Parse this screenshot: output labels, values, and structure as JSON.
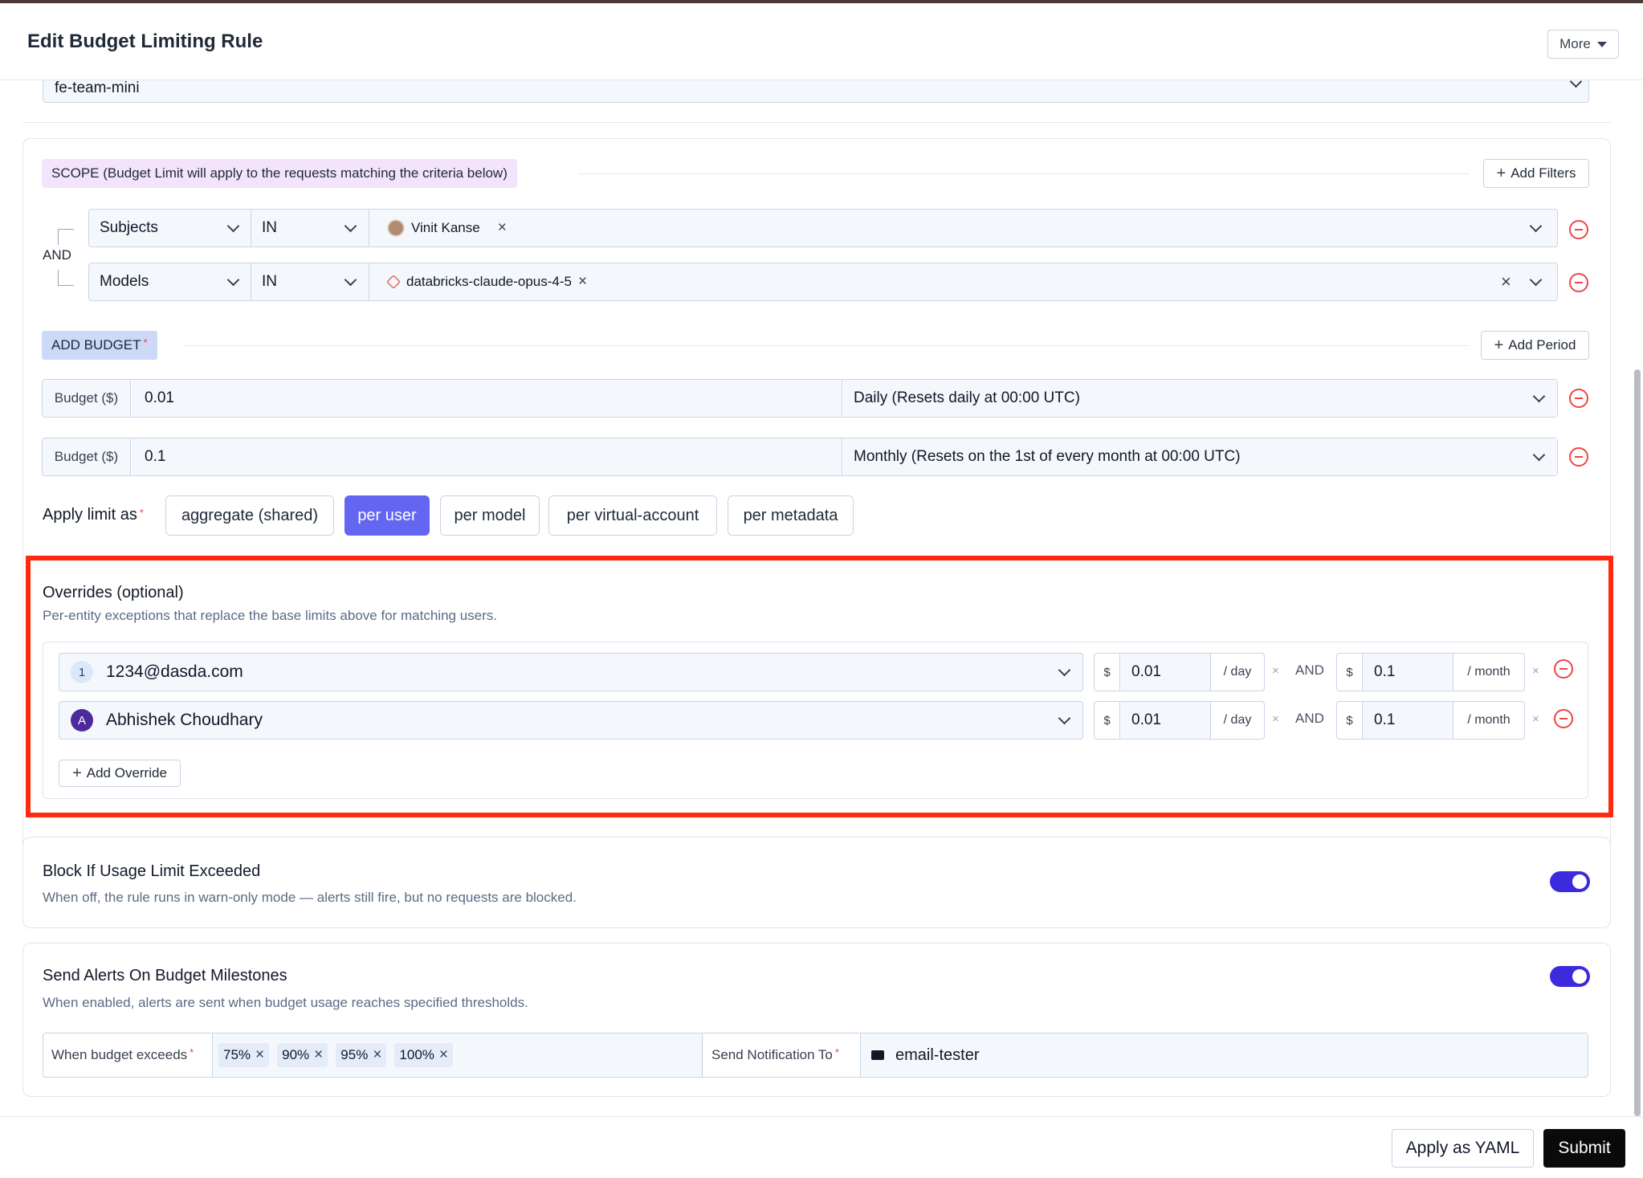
{
  "header": {
    "title": "Edit Budget Limiting Rule",
    "more_label": "More"
  },
  "top_select": {
    "value": "fe-team-mini"
  },
  "scope": {
    "label": "SCOPE (Budget Limit will apply to the requests matching the criteria below)",
    "add_filters_label": "Add Filters",
    "connector": "AND",
    "rules": [
      {
        "field": "Subjects",
        "operator": "IN",
        "values": [
          "Vinit Kanse"
        ]
      },
      {
        "field": "Models",
        "operator": "IN",
        "values": [
          "databricks-claude-opus-4-5"
        ]
      }
    ]
  },
  "budget": {
    "label": "ADD BUDGET",
    "add_period_label": "Add Period",
    "rows": [
      {
        "label": "Budget ($)",
        "value": "0.01",
        "period": "Daily (Resets daily at 00:00 UTC)"
      },
      {
        "label": "Budget ($)",
        "value": "0.1",
        "period": "Monthly (Resets on the 1st of every month at 00:00 UTC)"
      }
    ]
  },
  "apply_limit": {
    "label": "Apply limit as",
    "options": [
      "aggregate (shared)",
      "per user",
      "per model",
      "per virtual-account",
      "per metadata"
    ],
    "selected": "per user"
  },
  "overrides": {
    "title": "Overrides (optional)",
    "subtitle": "Per-entity exceptions that replace the base limits above for matching users.",
    "add_label": "Add Override",
    "items": [
      {
        "badge": "1",
        "entity": "1234@dasda.com",
        "currency": "$",
        "daily": "0.01",
        "daily_unit": "/ day",
        "and": "AND",
        "monthly": "0.1",
        "monthly_unit": "/ month"
      },
      {
        "badge": "A",
        "entity": "Abhishek Choudhary",
        "currency": "$",
        "daily": "0.01",
        "daily_unit": "/ day",
        "and": "AND",
        "monthly": "0.1",
        "monthly_unit": "/ month"
      }
    ]
  },
  "block": {
    "title": "Block If Usage Limit Exceeded",
    "subtitle": "When off, the rule runs in warn-only mode — alerts still fire, but no requests are blocked.",
    "enabled": true
  },
  "alerts": {
    "title": "Send Alerts On Budget Milestones",
    "subtitle": "When enabled, alerts are sent when budget usage reaches specified thresholds.",
    "enabled": true,
    "threshold_label": "When budget exceeds",
    "thresholds": [
      "75%",
      "90%",
      "95%",
      "100%"
    ],
    "notify_label": "Send Notification To",
    "recipient": "email-tester"
  },
  "footer": {
    "yaml_label": "Apply as YAML",
    "submit_label": "Submit"
  },
  "colors": {
    "accent": "#6366f1",
    "toggle": "#3b2bdc",
    "highlight_box": "#ff2a10",
    "danger": "#ef4444"
  }
}
